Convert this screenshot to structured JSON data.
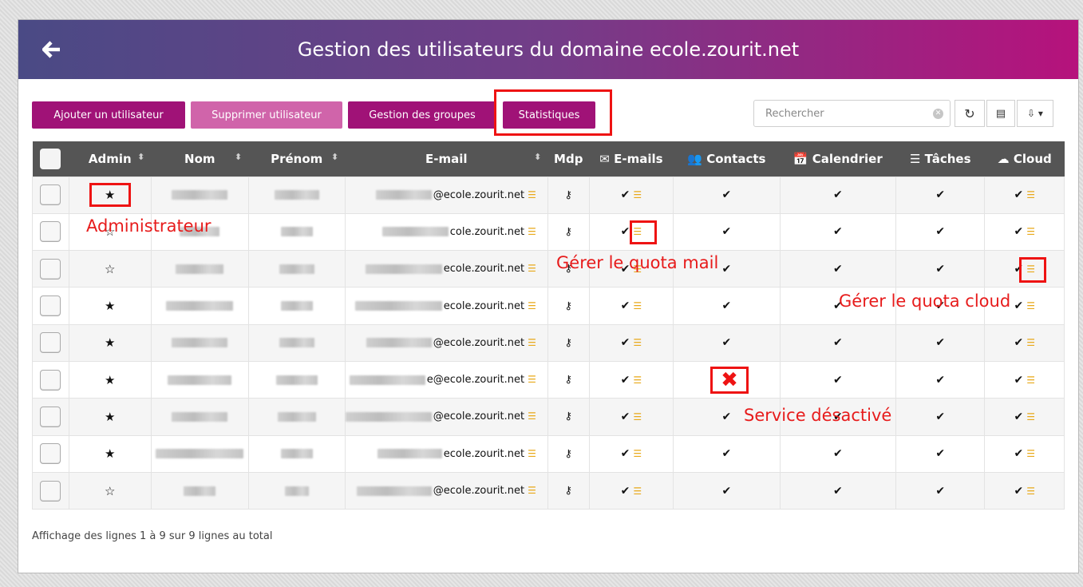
{
  "header": {
    "title": "Gestion des utilisateurs du domaine ecole.zourit.net"
  },
  "toolbar": {
    "add_user": "Ajouter un utilisateur",
    "delete_user": "Supprimer utilisateur",
    "groups": "Gestion des groupes",
    "stats": "Statistiques",
    "search_placeholder": "Rechercher"
  },
  "columns": {
    "admin": "Admin",
    "nom": "Nom",
    "prenom": "Prénom",
    "email": "E-mail",
    "mdp": "Mdp",
    "emails": "E-mails",
    "contacts": "Contacts",
    "calendrier": "Calendrier",
    "taches": "Tâches",
    "cloud": "Cloud"
  },
  "rows": [
    {
      "admin": "★",
      "email": "@ecole.zourit.net",
      "contacts": "✔"
    },
    {
      "admin": "☆",
      "email": "cole.zourit.net",
      "contacts": "✔"
    },
    {
      "admin": "☆",
      "email": "ecole.zourit.net",
      "contacts": "✔"
    },
    {
      "admin": "★",
      "email": "ecole.zourit.net",
      "contacts": "✔"
    },
    {
      "admin": "★",
      "email": "@ecole.zourit.net",
      "contacts": "✔"
    },
    {
      "admin": "★",
      "email": "e@ecole.zourit.net",
      "contacts": ""
    },
    {
      "admin": "★",
      "email": "@ecole.zourit.net",
      "contacts": "✔"
    },
    {
      "admin": "★",
      "email": "ecole.zourit.net",
      "contacts": "✔"
    },
    {
      "admin": "☆",
      "email": "@ecole.zourit.net",
      "contacts": "✔"
    }
  ],
  "annotations": {
    "admin": "Administrateur",
    "quota_mail": "Gérer le quota mail",
    "quota_cloud": "Gérer le quota cloud",
    "service_off": "Service désactivé"
  },
  "footer": "Affichage des lignes 1 à 9 sur 9 lignes au total",
  "colors": {
    "primary": "#a01277",
    "primary_light": "#d064aa",
    "annotation": "#ee1313",
    "header_dark": "#555555"
  }
}
